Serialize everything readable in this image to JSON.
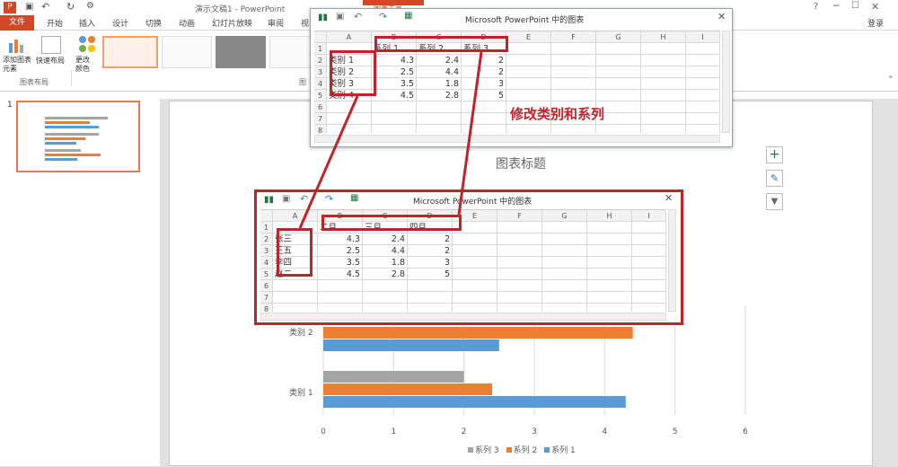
{
  "app": {
    "doc_title": "演示文稿1 - PowerPoint",
    "tool_context": "图表工具",
    "help": "?",
    "signin": "登录"
  },
  "tabs": [
    "文件",
    "开始",
    "插入",
    "设计",
    "切换",
    "动画",
    "幻灯片放映",
    "审阅",
    "视"
  ],
  "ribbon": {
    "add_element": "添加图表\n元素",
    "quick_layout": "快速布局",
    "change_colors": "更改\n颜色",
    "group_layout": "图表布局",
    "group_styles": "图"
  },
  "slide_panel": {
    "number": "1"
  },
  "dialog1": {
    "title": "Microsoft PowerPoint 中的图表",
    "cols": [
      "",
      "A",
      "B",
      "C",
      "D",
      "E",
      "F",
      "G",
      "H",
      "I"
    ],
    "rows": [
      [
        "1",
        "",
        "系列 1",
        "系列 2",
        "系列 3"
      ],
      [
        "2",
        "类别 1",
        "4.3",
        "2.4",
        "2"
      ],
      [
        "3",
        "类别 2",
        "2.5",
        "4.4",
        "2"
      ],
      [
        "4",
        "类别 3",
        "3.5",
        "1.8",
        "3"
      ],
      [
        "5",
        "类别 4",
        "4.5",
        "2.8",
        "5"
      ],
      [
        "6",
        "",
        "",
        "",
        ""
      ],
      [
        "7",
        "",
        "",
        "",
        ""
      ],
      [
        "8",
        "",
        "",
        "",
        ""
      ]
    ]
  },
  "dialog2": {
    "title": "Microsoft PowerPoint 中的图表",
    "cols": [
      "",
      "A",
      "B",
      "C",
      "D",
      "E",
      "F",
      "G",
      "H",
      "I"
    ],
    "rows": [
      [
        "1",
        "",
        "二月",
        "三月",
        "四月"
      ],
      [
        "2",
        "张三",
        "4.3",
        "2.4",
        "2"
      ],
      [
        "3",
        "王五",
        "2.5",
        "4.4",
        "2"
      ],
      [
        "4",
        "李四",
        "3.5",
        "1.8",
        "3"
      ],
      [
        "5",
        "赵二",
        "4.5",
        "2.8",
        "5"
      ],
      [
        "6",
        "",
        "",
        "",
        ""
      ],
      [
        "7",
        "",
        "",
        "",
        ""
      ],
      [
        "8",
        "",
        "",
        "",
        ""
      ]
    ]
  },
  "annotation": "修改类别和系列",
  "chart_data": {
    "type": "bar",
    "title": "图表标题",
    "categories": [
      "类别 1",
      "类别 2"
    ],
    "series": [
      {
        "name": "系列 1",
        "values": [
          4.3,
          2.5
        ],
        "color": "#5b9bd5"
      },
      {
        "name": "系列 2",
        "values": [
          2.4,
          4.4
        ],
        "color": "#ed7d31"
      },
      {
        "name": "系列 3",
        "values": [
          2,
          null
        ],
        "color": "#a5a5a5"
      }
    ],
    "xticks": [
      "0",
      "1",
      "2",
      "3",
      "4",
      "5",
      "6"
    ],
    "xlim": [
      0,
      6
    ],
    "legend": "bottom",
    "legend_entries": [
      "系列 3",
      "系列 2",
      "系列 1"
    ]
  },
  "side_buttons": {
    "plus": "+",
    "brush": "✎",
    "filter": "▼"
  }
}
